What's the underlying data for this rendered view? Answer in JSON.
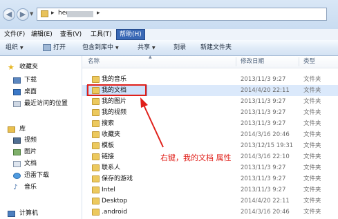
{
  "address": {
    "crumb": "heq",
    "blurred": true
  },
  "menubar": {
    "items": [
      "文件(F)",
      "编辑(E)",
      "查看(V)",
      "工具(T)",
      "帮助(H)"
    ]
  },
  "toolbar": {
    "organize": "组织",
    "print": "打开",
    "include_library": "包含到库中",
    "share": "共享",
    "burn": "刻录",
    "new_folder": "新建文件夹"
  },
  "sidebar": {
    "favorites_header": "收藏夹",
    "favorites": [
      "下载",
      "桌面",
      "最近访问的位置"
    ],
    "libraries_header": "库",
    "libraries": [
      "视频",
      "图片",
      "文档",
      "迅雷下载",
      "音乐"
    ],
    "computer": "计算机"
  },
  "columns": {
    "name": "名称",
    "modified": "修改日期",
    "type": "类型"
  },
  "files": [
    {
      "name": "我的音乐",
      "date": "2013/11/3 9:27",
      "type": "文件夹"
    },
    {
      "name": "我的文档",
      "date": "2014/4/20 22:11",
      "type": "文件夹",
      "selected": true
    },
    {
      "name": "我的图片",
      "date": "2013/11/3 9:27",
      "type": "文件夹"
    },
    {
      "name": "我的视频",
      "date": "2013/11/3 9:27",
      "type": "文件夹"
    },
    {
      "name": "搜索",
      "date": "2013/11/3 9:27",
      "type": "文件夹"
    },
    {
      "name": "收藏夹",
      "date": "2014/3/16 20:46",
      "type": "文件夹"
    },
    {
      "name": "模板",
      "date": "2013/12/15 19:31",
      "type": "文件夹"
    },
    {
      "name": "链接",
      "date": "2014/3/16 22:10",
      "type": "文件夹"
    },
    {
      "name": "联系人",
      "date": "2013/11/3 9:27",
      "type": "文件夹"
    },
    {
      "name": "保存的游戏",
      "date": "2013/11/3 9:27",
      "type": "文件夹"
    },
    {
      "name": "Intel",
      "date": "2013/11/3 9:27",
      "type": "文件夹"
    },
    {
      "name": "Desktop",
      "date": "2014/4/20 22:11",
      "type": "文件夹"
    },
    {
      "name": ".android",
      "date": "2014/3/16 20:46",
      "type": "文件夹"
    }
  ],
  "annotation": "右键，我的文档 属性",
  "colors": {
    "highlight": "#e0201a",
    "selection": "#dbe9fb",
    "menu_active": "#3a69b6"
  }
}
